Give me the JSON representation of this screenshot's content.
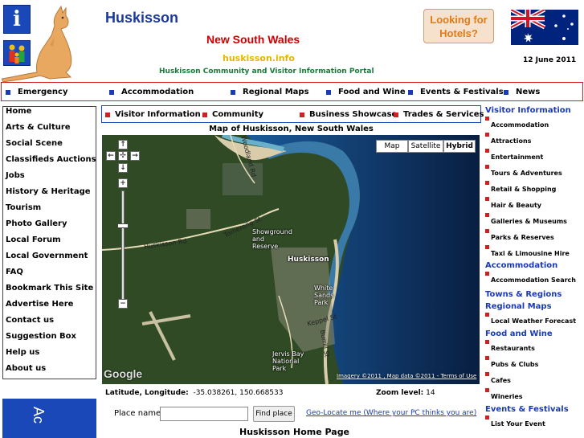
{
  "header": {
    "info_icon_letter": "i",
    "site_title": "Huskisson",
    "state": "New South Wales",
    "domain": "huskisson.info",
    "tagline": "Huskisson Community and Visitor Information Portal",
    "hotels_button": "Looking for Hotels?",
    "date": "12 June 2011"
  },
  "top_nav": {
    "items": [
      "Emergency",
      "Accommodation",
      "Regional Maps",
      "Food and Wine",
      "Events & Festivals",
      "News"
    ]
  },
  "left_menu": {
    "items": [
      "Home",
      "Arts & Culture",
      "Social Scene",
      "Classifieds Auctions",
      "Jobs",
      "History & Heritage",
      "Tourism",
      "Photo Gallery",
      "Local Forum",
      "Local Government",
      "FAQ",
      "Bookmark This Site",
      "Advertise Here",
      "Contact us",
      "Suggestion Box",
      "Help us",
      "About us"
    ],
    "banner_text": "Ac"
  },
  "sub_nav": {
    "items": [
      "Visitor Information",
      "Community",
      "Business Showcase",
      "Trades & Services"
    ]
  },
  "map": {
    "title": "Map of Huskisson, New South Wales",
    "type_buttons": [
      "Map",
      "Satellite",
      "Hybrid"
    ],
    "active_type": "Hybrid",
    "labels": {
      "huskisson": "Huskisson",
      "showground": "Showground and Reserve",
      "white_sands": "White Sands Park",
      "jervis_bay": "Jervis Bay National Park",
      "huskisson_rd": "Huskisson Rd",
      "tomerong_st": "Tomerong St",
      "keppel_st": "Keppel St",
      "burrill_st": "Burrill St",
      "woodland_rd": "Woodland Rd"
    },
    "google_logo": "Google",
    "imagery_credit": "Imagery ©2011 , Map data ©2011 - Terms of Use",
    "pan_up": "↑",
    "pan_left": "←",
    "pan_center": "✣",
    "pan_right": "→",
    "pan_down": "↓",
    "zoom_in": "+",
    "zoom_out": "−"
  },
  "coords": {
    "latlon_label": "Latitude, Longitude:",
    "latlon_value": "-35.038261, 150.668533",
    "zoom_label": "Zoom level:",
    "zoom_value": "14"
  },
  "search": {
    "place_label": "Place name:",
    "place_value": "",
    "find_button": "Find place",
    "geolocate_link": "Geo-Locate me (Where your PC thinks you are)"
  },
  "footer": {
    "home_page_title": "Huskisson Home Page"
  },
  "right_menu": {
    "visitor_info_header": "Visitor Information",
    "visitor_items": [
      "Accommodation",
      "Attractions",
      "Entertainment",
      "Tours & Adventures",
      "Retail & Shopping",
      "Hair & Beauty",
      "Galleries & Museums",
      "Parks & Reserves",
      "Taxi & Limousine Hire"
    ],
    "accommodation_header": "Accommodation",
    "accommodation_items": [
      "Accommodation Search"
    ],
    "towns_header": "Towns & Regions",
    "regional_maps_header": "Regional Maps",
    "regional_items": [
      "Local Weather Forecast"
    ],
    "food_header": "Food and Wine",
    "food_items": [
      "Restaurants",
      "Pubs & Clubs",
      "Cafes",
      "Wineries"
    ],
    "events_header": "Events & Festivals",
    "events_items": [
      "List Your Event"
    ]
  },
  "colors": {
    "brand_blue": "#1a3a9a",
    "state_red": "#cc0000",
    "domain_yellow": "#e8b400",
    "tagline_green": "#1a7a3a",
    "nav_square_blue": "#1a3ab8",
    "nav_square_red": "#cc2222"
  }
}
